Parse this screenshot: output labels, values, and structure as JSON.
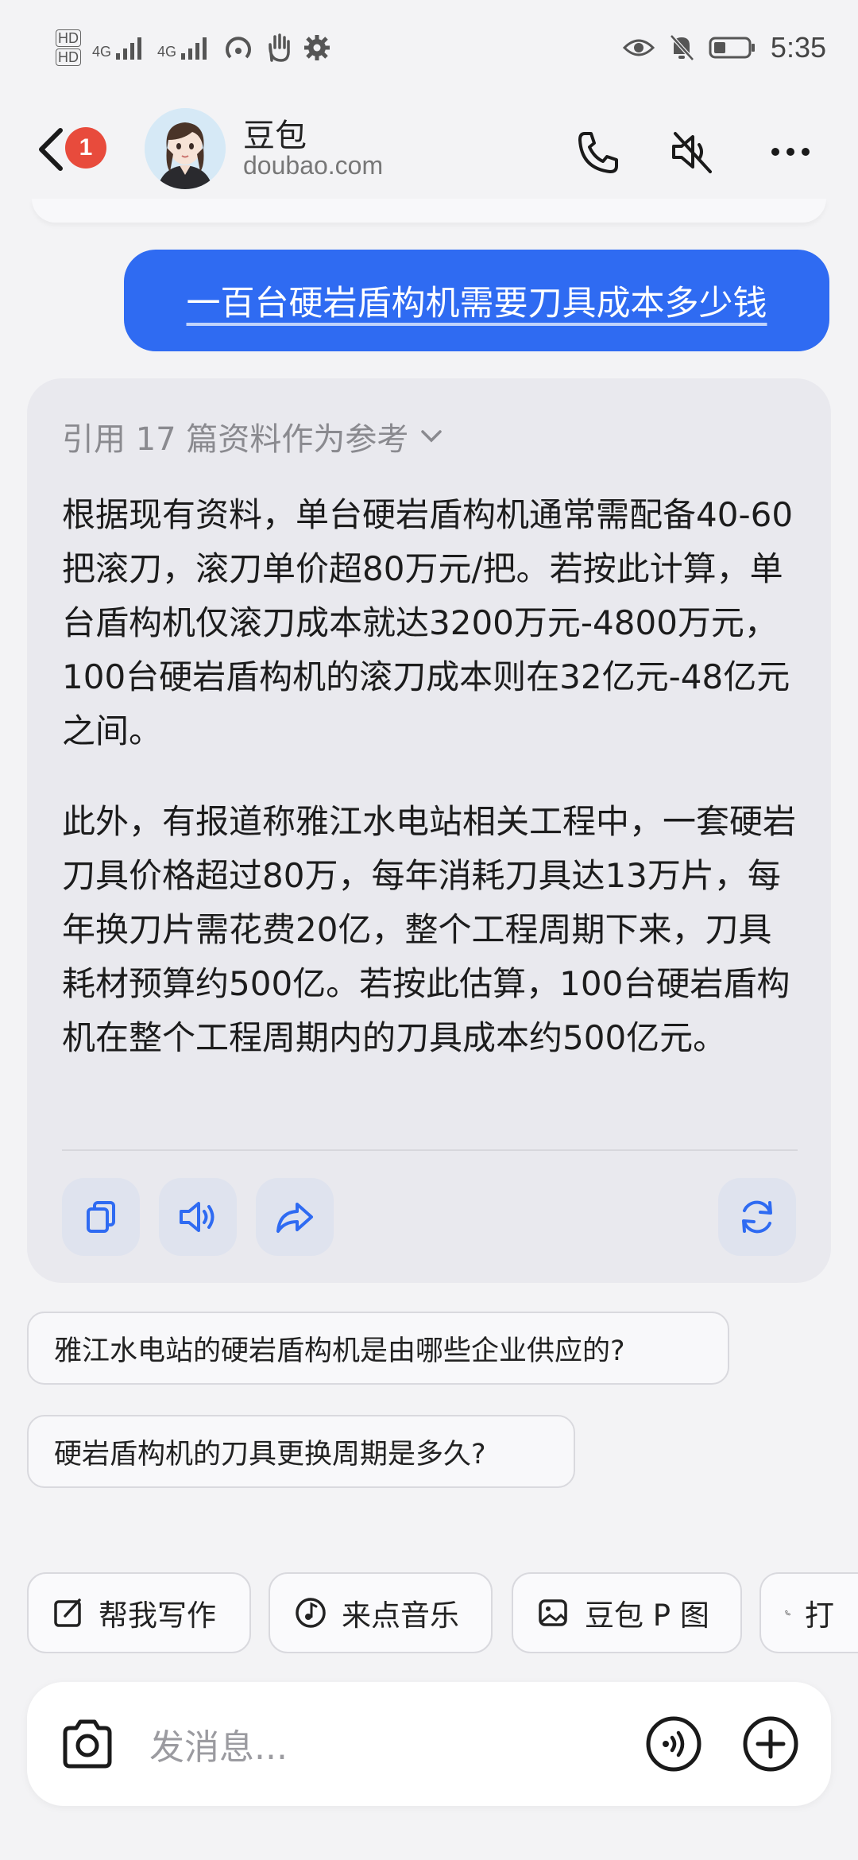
{
  "status_bar": {
    "time": "5:35",
    "left_labels": [
      "HD",
      "HD",
      "4G",
      "4G"
    ],
    "icons": [
      "hd-icon",
      "signal-icon",
      "signal-icon",
      "hotspot-icon",
      "hand-icon",
      "gear-icon",
      "eye-icon",
      "mute-bell-icon",
      "battery-icon"
    ]
  },
  "header": {
    "name": "豆包",
    "subtitle": "doubao.com",
    "unread_badge": "1"
  },
  "user_message": "一百台硬岩盾构机需要刀具成本多少钱",
  "answer": {
    "reference_label": "引用 17 篇资料作为参考",
    "paragraphs": [
      "根据现有资料，单台硬岩盾构机通常需配备40-60把滚刀，滚刀单价超80万元/把。若按此计算，单台盾构机仅滚刀成本就达3200万元-4800万元，100台硬岩盾构机的滚刀成本则在32亿元-48亿元之间。",
      "此外，有报道称雅江水电站相关工程中，一套硬岩刀具价格超过80万，每年消耗刀具达13万片，每年换刀片需花费20亿，整个工程周期下来，刀具耗材预算约500亿。若按此估算，100台硬岩盾构机在整个工程周期内的刀具成本约500亿元。"
    ]
  },
  "suggestions": [
    "雅江水电站的硬岩盾构机是由哪些企业供应的?",
    "硬岩盾构机的刀具更换周期是多久?"
  ],
  "quick_actions": [
    {
      "label": "帮我写作",
      "icon": "edit-icon"
    },
    {
      "label": "来点音乐",
      "icon": "music-icon"
    },
    {
      "label": "豆包 P 图",
      "icon": "image-edit-icon"
    },
    {
      "label": "打",
      "icon": "phone-icon"
    }
  ],
  "input": {
    "placeholder": "发消息..."
  },
  "colors": {
    "accent": "#2f6bf2",
    "background": "#f3f3f5",
    "card": "#e9e9ee",
    "badge": "#e84b3c"
  }
}
